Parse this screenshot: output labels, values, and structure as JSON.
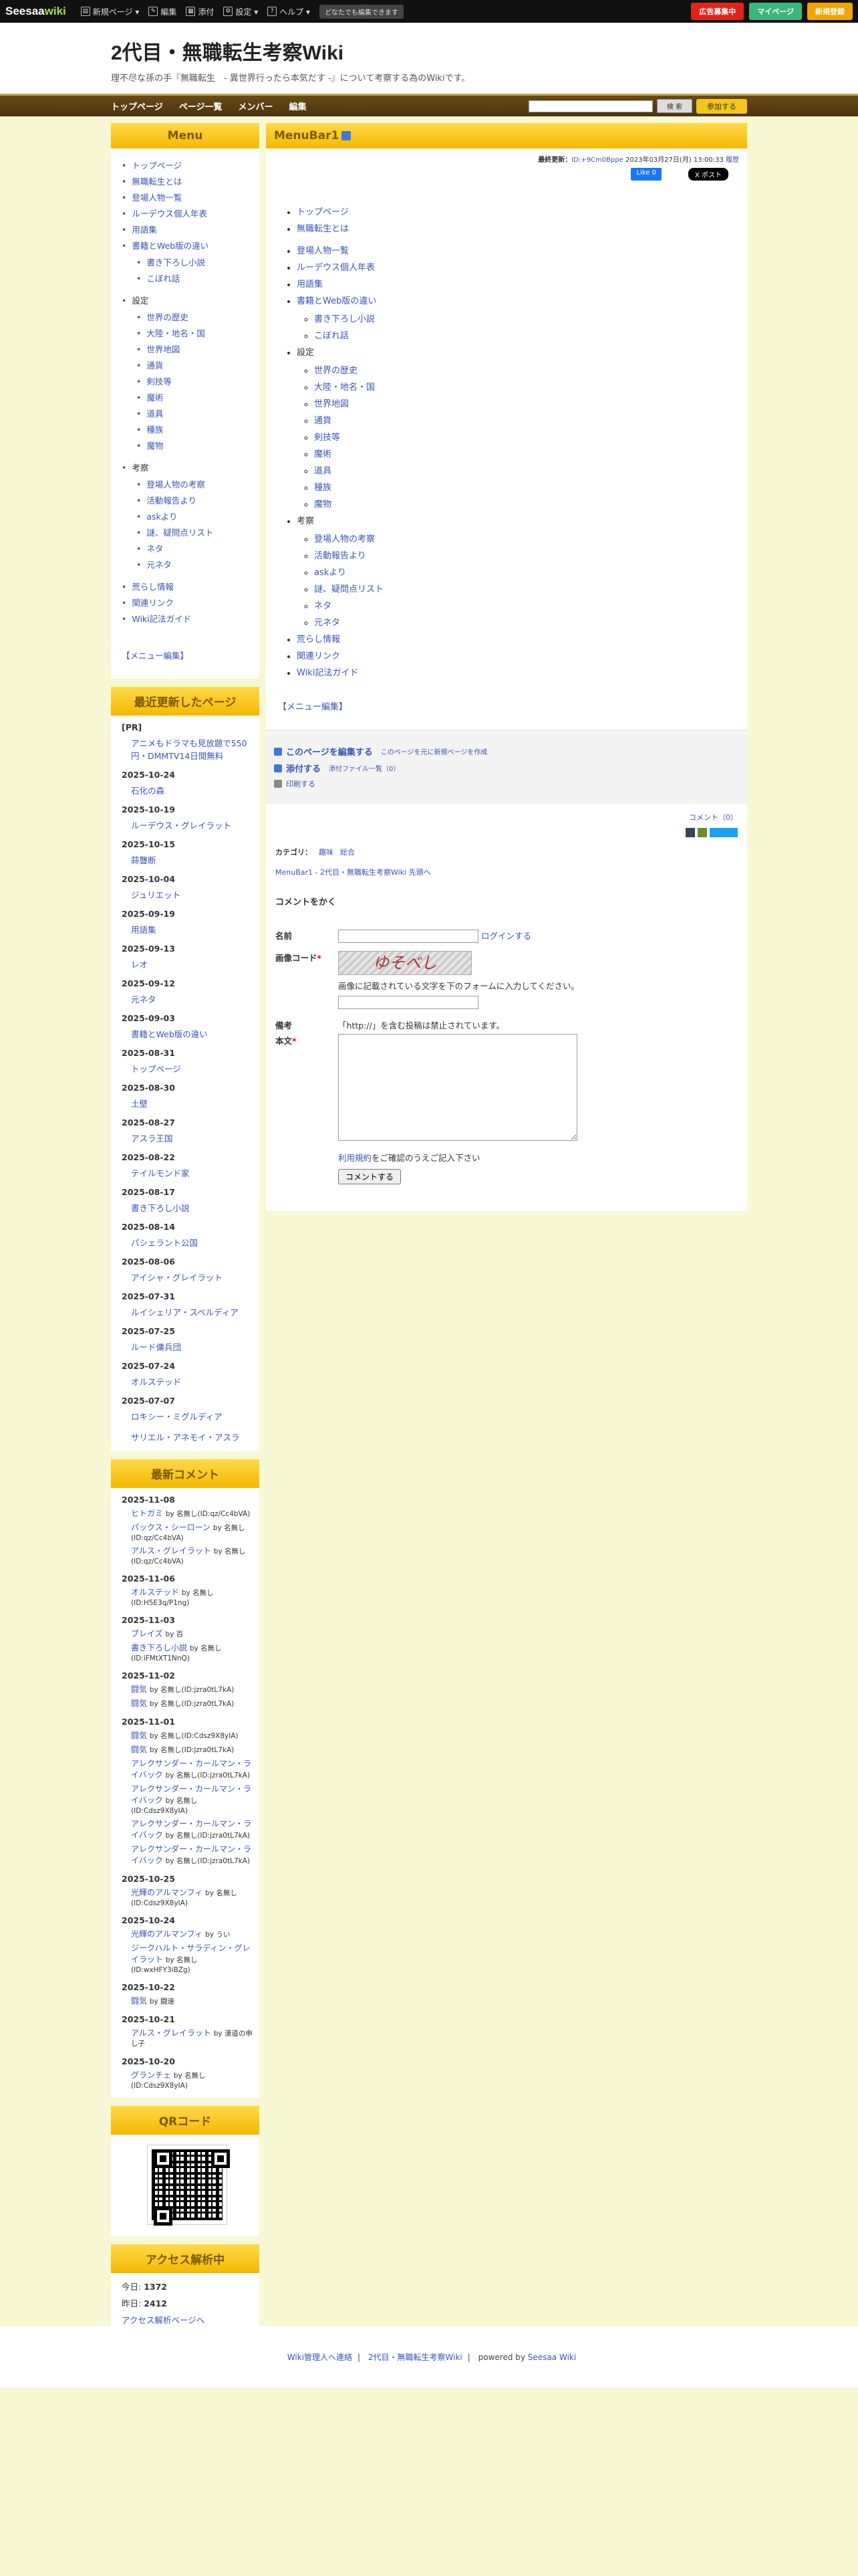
{
  "topbar": {
    "logo_main": "Seesaa",
    "logo_wiki": "wiki",
    "items": [
      "新規ページ ▾",
      "編集",
      "添付",
      "設定 ▾",
      "ヘルプ ▾"
    ],
    "anyone_edit": "どなたでも編集できます",
    "btn_ads": "広告募集中",
    "btn_mypage": "マイページ",
    "btn_register": "新規登録"
  },
  "header": {
    "title": "2代目・無職転生考察Wiki",
    "desc": "理不尽な孫の手『無職転生　- 異世界行ったら本気だす -』について考察する為のWikiです。"
  },
  "nav": {
    "items": [
      "トップページ",
      "ページ一覧",
      "メンバー",
      "編集"
    ],
    "search_btn": "検 索",
    "join_btn": "参加する"
  },
  "menu": {
    "title": "Menu",
    "top": [
      "トップページ",
      "無職転生とは",
      "登場人物一覧",
      "ルーデウス個人年表",
      "用語集",
      "書籍とWeb版の違い"
    ],
    "books_sub": [
      "書き下ろし小説",
      "こぼれ話"
    ],
    "settings": "設定",
    "settings_sub": [
      "世界の歴史",
      "大陸・地名・国",
      "世界地図",
      "通貨",
      "剣技等",
      "魔術",
      "道具",
      "種族",
      "魔物"
    ],
    "study": "考察",
    "study_sub": [
      "登場人物の考察",
      "活動報告より",
      "askより",
      "謎、疑問点リスト",
      "ネタ",
      "元ネタ"
    ],
    "bottom": [
      "荒らし情報",
      "関連リンク",
      "Wiki記法ガイド"
    ],
    "edit": "【メニュー編集】"
  },
  "recent": {
    "title": "最近更新したページ",
    "pr": "[PR]",
    "pr_link": "アニメもドラマも見放題で550円・DMMTV14日間無料",
    "entries": [
      {
        "date": "2025-10-24",
        "page": "石化の森"
      },
      {
        "date": "2025-10-19",
        "page": "ルーデウス・グレイラット"
      },
      {
        "date": "2025-10-15",
        "page": "蒜聾断"
      },
      {
        "date": "2025-10-04",
        "page": "ジュリエット"
      },
      {
        "date": "2025-09-19",
        "page": "用語集"
      },
      {
        "date": "2025-09-13",
        "page": "レオ"
      },
      {
        "date": "2025-09-12",
        "page": "元ネタ"
      },
      {
        "date": "2025-09-03",
        "page": "書籍とWeb版の違い"
      },
      {
        "date": "2025-08-31",
        "page": "トップページ"
      },
      {
        "date": "2025-08-30",
        "page": "土壁"
      },
      {
        "date": "2025-08-27",
        "page": "アスラ王国"
      },
      {
        "date": "2025-08-22",
        "page": "テイルモンド家"
      },
      {
        "date": "2025-08-17",
        "page": "書き下ろし小説"
      },
      {
        "date": "2025-08-14",
        "page": "パシェラント公国"
      },
      {
        "date": "2025-08-06",
        "page": "アイシャ・グレイラット"
      },
      {
        "date": "2025-07-31",
        "page": "ルイシェリア・スペルディア"
      },
      {
        "date": "2025-07-25",
        "page": "ルード傭兵団"
      },
      {
        "date": "2025-07-24",
        "page": "オルステッド"
      },
      {
        "date": "2025-07-07",
        "page": "ロキシー・ミグルディア"
      }
    ],
    "last": "サリエル・アネモイ・アスラ"
  },
  "comments": {
    "title": "最新コメント",
    "groups": [
      {
        "date": "2025-11-08",
        "items": [
          {
            "page": "ヒトガミ",
            "by": "by 名無し(ID:qz/Cc4bVA)"
          },
          {
            "page": "パックス・シーローン",
            "by": "by 名無し(ID:qz/Cc4bVA)"
          },
          {
            "page": "アルス・グレイラット",
            "by": "by 名無し(ID:qz/Cc4bVA)"
          }
        ]
      },
      {
        "date": "2025-11-06",
        "items": [
          {
            "page": "オルステッド",
            "by": "by 名無し(ID:H5E3q/P1ng)"
          }
        ]
      },
      {
        "date": "2025-11-03",
        "items": [
          {
            "page": "ブレイズ",
            "by": "by 百"
          },
          {
            "page": "書き下ろし小説",
            "by": "by 名無し(ID:iFMtXT1NnQ)"
          }
        ]
      },
      {
        "date": "2025-11-02",
        "items": [
          {
            "page": "闘気",
            "by": "by 名無し(ID:jzra0tL7kA)"
          },
          {
            "page": "闘気",
            "by": "by 名無し(ID:jzra0tL7kA)"
          }
        ]
      },
      {
        "date": "2025-11-01",
        "items": [
          {
            "page": "闘気",
            "by": "by 名無し(ID:Cdsz9X8yIA)"
          },
          {
            "page": "闘気",
            "by": "by 名無し(ID:jzra0tL7kA)"
          },
          {
            "page": "アレクサンダー・カールマン・ライバック",
            "by": "by 名無し(ID:jzra0tL7kA)"
          },
          {
            "page": "アレクサンダー・カールマン・ライバック",
            "by": "by 名無し(ID:Cdsz9X8yIA)"
          },
          {
            "page": "アレクサンダー・カールマン・ライバック",
            "by": "by 名無し(ID:jzra0tL7kA)"
          },
          {
            "page": "アレクサンダー・カールマン・ライバック",
            "by": "by 名無し(ID:jzra0tL7kA)"
          }
        ]
      },
      {
        "date": "2025-10-25",
        "items": [
          {
            "page": "光輝のアルマンフィ",
            "by": "by 名無し(ID:Cdsz9X8yIA)"
          }
        ]
      },
      {
        "date": "2025-10-24",
        "items": [
          {
            "page": "光輝のアルマンフィ",
            "by": "by うい"
          },
          {
            "page": "ジークハルト・サラディン・グレイラット",
            "by": "by 名無し(ID:wxHFY3iBZg)"
          }
        ]
      },
      {
        "date": "2025-10-22",
        "items": [
          {
            "page": "闘気",
            "by": "by 闘速"
          }
        ]
      },
      {
        "date": "2025-10-21",
        "items": [
          {
            "page": "アルス・グレイラット",
            "by": "by 漠道の申し子"
          }
        ]
      },
      {
        "date": "2025-10-20",
        "items": [
          {
            "page": "グランチェ",
            "by": "by 名無し(ID:Cdsz9X8yIA)"
          }
        ]
      }
    ]
  },
  "qr": {
    "title": "QRコード"
  },
  "access": {
    "title": "アクセス解析中",
    "today_label": "今日: ",
    "today": "1372",
    "yesterday_label": "昨日: ",
    "yesterday": "2412",
    "link": "アクセス解析ページへ"
  },
  "main": {
    "title": "MenuBar1",
    "meta_label": "最終更新：",
    "meta_id": "ID:+9Cm0Bppe",
    "meta_date": "2023年03月27日(月) 13:00:33",
    "meta_history": "履歴",
    "fb": "Like 0",
    "tw": "X ポスト",
    "edit_page": "このページを編集する",
    "edit_new": "このページを元に新規ページを作成",
    "attach": "添付する",
    "attach_list": "添付ファイル一覧（0）",
    "print": "印刷する",
    "comment_count": "コメント（0）",
    "cat_label": "カテゴリ：",
    "cats": [
      "趣味",
      "総合"
    ],
    "crumb": "MenuBar1 - 2代目・無職転生考察Wiki 先頭へ",
    "form_title": "コメントをかく",
    "name_label": "名前",
    "login": "ログインする",
    "captcha_label": "画像コード",
    "captcha_text": "ゆそべし",
    "captcha_note": "画像に記載されている文字を下のフォームに入力してください。",
    "note_label": "備考",
    "note_text": "「http://」を含む投稿は禁止されています。",
    "body_label": "本文",
    "terms_link": "利用規約",
    "terms_text": "をご確認のうえご記入下さい",
    "submit": "コメントする"
  },
  "footer": {
    "link1": "Wiki管理人へ連絡",
    "link2": "2代目・無職転生考察Wiki",
    "powered": "powered by ",
    "brand": "Seesaa Wiki"
  }
}
